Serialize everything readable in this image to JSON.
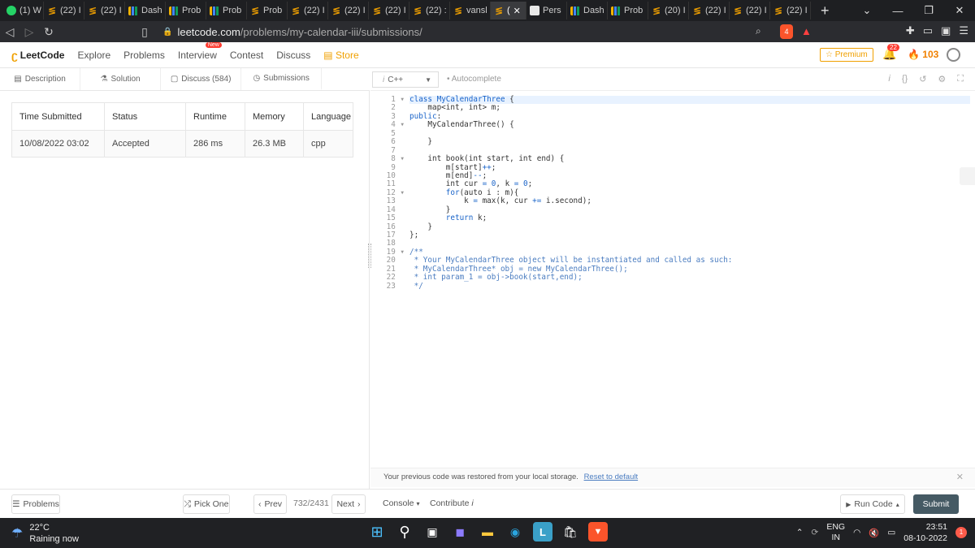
{
  "browser": {
    "tabs": [
      {
        "label": "(1) W",
        "icon": "whatsapp"
      },
      {
        "label": "(22) I",
        "icon": "leetcode"
      },
      {
        "label": "(22) I",
        "icon": "leetcode"
      },
      {
        "label": "Dash",
        "icon": "bars"
      },
      {
        "label": "Prob",
        "icon": "bars"
      },
      {
        "label": "Prob",
        "icon": "bars"
      },
      {
        "label": "Prob",
        "icon": "leetcode"
      },
      {
        "label": "(22) I",
        "icon": "leetcode"
      },
      {
        "label": "(22) I",
        "icon": "leetcode"
      },
      {
        "label": "(22) I",
        "icon": "leetcode"
      },
      {
        "label": "(22) :",
        "icon": "leetcode"
      },
      {
        "label": "vansl",
        "icon": "leetcode"
      },
      {
        "label": "(",
        "icon": "leetcode",
        "active": true
      },
      {
        "label": "Pers",
        "icon": "v"
      },
      {
        "label": "Dash",
        "icon": "bars"
      },
      {
        "label": "Prob",
        "icon": "bars"
      },
      {
        "label": "(20) I",
        "icon": "leetcode"
      },
      {
        "label": "(22) I",
        "icon": "leetcode"
      },
      {
        "label": "(22) I",
        "icon": "leetcode"
      },
      {
        "label": "(22) I",
        "icon": "leetcode"
      }
    ],
    "url_host": "leetcode.com",
    "url_path": "/problems/my-calendar-iii/submissions/",
    "brave_badge": "4",
    "rewards_badge": "1"
  },
  "header": {
    "logo": "LeetCode",
    "nav": [
      "Explore",
      "Problems",
      "Interview",
      "Contest",
      "Discuss"
    ],
    "new_badge": "New",
    "store": "Store",
    "premium": "Premium",
    "notifications": "22",
    "coins": "103"
  },
  "left_tabs": [
    "Description",
    "Solution",
    "Discuss (584)",
    "Submissions"
  ],
  "submissions": {
    "headers": [
      "Time Submitted",
      "Status",
      "Runtime",
      "Memory",
      "Language"
    ],
    "rows": [
      [
        "10/08/2022 03:02",
        "Accepted",
        "286 ms",
        "26.3 MB",
        "cpp"
      ]
    ]
  },
  "editor": {
    "language": "C++",
    "autocomplete": "Autocomplete",
    "restore_msg": "Your previous code was restored from your local storage.",
    "reset_link": "Reset to default"
  },
  "bottom": {
    "problems": "Problems",
    "pick_one": "Pick One",
    "prev": "Prev",
    "counter": "732/2431",
    "next": "Next",
    "console": "Console",
    "contribute": "Contribute",
    "run_code": "Run Code",
    "submit": "Submit"
  },
  "taskbar": {
    "temp": "22°C",
    "weather": "Raining now",
    "lang1": "ENG",
    "lang2": "IN",
    "time": "23:51",
    "date": "08-10-2022",
    "notif_count": "1"
  }
}
